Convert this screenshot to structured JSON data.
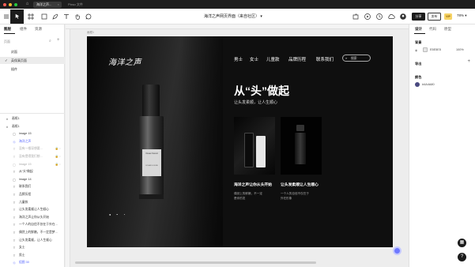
{
  "os": {
    "tabs": [
      {
        "label": "海洋之声...",
        "active": true
      },
      {
        "label": "Pixso 文件",
        "active": false
      }
    ],
    "colors": {
      "close": "#ff5f56",
      "min": "#ffbd2e",
      "max": "#27c93f"
    }
  },
  "toolbar": {
    "title": "海洋之声网页界面（来自社区）",
    "share_label": "分享",
    "publish_label": "发布",
    "vip_label": "VIP",
    "zoom": "78%"
  },
  "left_panel": {
    "tabs": [
      "图层",
      "组件",
      "资源"
    ],
    "pages_label": "页面",
    "pages": [
      {
        "label": "封面",
        "selected": false
      },
      {
        "label": "英保真页面",
        "selected": true
      },
      {
        "label": "插件",
        "selected": false
      }
    ],
    "layers": [
      {
        "label": "画框1",
        "icon": "#",
        "indent": 0,
        "style": "normal"
      },
      {
        "label": "画框1",
        "icon": "#",
        "indent": 0,
        "style": "normal"
      },
      {
        "label": "image 15",
        "icon": "▢",
        "indent": 1,
        "style": "normal"
      },
      {
        "label": "海洋之声",
        "icon": "◇",
        "indent": 1,
        "style": "blue"
      },
      {
        "label": "没有一根深想要...",
        "icon": "T",
        "indent": 1,
        "style": "grey"
      },
      {
        "label": "没有提得我们想...",
        "icon": "T",
        "indent": 1,
        "style": "grey"
      },
      {
        "label": "image 15",
        "icon": "▢",
        "indent": 1,
        "style": "grey"
      },
      {
        "label": "从“头”做起",
        "icon": "T",
        "indent": 1,
        "style": "normal"
      },
      {
        "label": "image 14",
        "icon": "▢",
        "indent": 1,
        "style": "normal"
      },
      {
        "label": "联系我们",
        "icon": "T",
        "indent": 1,
        "style": "normal"
      },
      {
        "label": "品牌历程",
        "icon": "T",
        "indent": 1,
        "style": "normal"
      },
      {
        "label": "儿童款",
        "icon": "T",
        "indent": 1,
        "style": "normal"
      },
      {
        "label": "让头发柔顺让人生顺心",
        "icon": "T",
        "indent": 1,
        "style": "normal"
      },
      {
        "label": "海洋之声让你从头开始",
        "icon": "T",
        "indent": 1,
        "style": "normal"
      },
      {
        "label": "一个人的自信不仅在于外在...",
        "icon": "T",
        "indent": 1,
        "style": "normal"
      },
      {
        "label": "偶然上的鲜嫩，不一定是梦...",
        "icon": "T",
        "indent": 1,
        "style": "normal"
      },
      {
        "label": "让头发柔顺，让人生顺心",
        "icon": "T",
        "indent": 1,
        "style": "normal"
      },
      {
        "label": "女士",
        "icon": "T",
        "indent": 1,
        "style": "normal"
      },
      {
        "label": "男士",
        "icon": "T",
        "indent": 1,
        "style": "normal"
      },
      {
        "label": "组图 30",
        "icon": "◇",
        "indent": 1,
        "style": "blue"
      }
    ]
  },
  "canvas": {
    "frame_label": "画框1"
  },
  "design": {
    "brand": "海洋之声",
    "nav": [
      "男士",
      "女士",
      "儿童款",
      "品牌历程",
      "联系我们"
    ],
    "search_placeholder": "搜索",
    "headline": "从“头”做起",
    "subline": "让头发柔顺，让人生顺心",
    "bottle_label_top": "Ocean Sound",
    "bottle_label_mid": "OCEAN SOUND",
    "cards": [
      {
        "title": "海洋之声让你从头开始",
        "desc1": "偶然上的鲜嫩，不一定",
        "desc2": "是你的发",
        "image": "bottle-card-white"
      },
      {
        "title": "让头发柔顺让人生顺心",
        "desc1": "一个人的自信不仅在于",
        "desc2": "外在形象",
        "image": "bottle-card-black"
      }
    ],
    "colors": {
      "background": "#0f0f0f",
      "accent_text": "#ffffff"
    }
  },
  "right_panel": {
    "tabs": [
      "设计",
      "代码",
      "原型"
    ],
    "background_label": "背景",
    "bg_hex": "E5E5E5",
    "bg_opacity": "100%",
    "export_label": "导出",
    "color_label": "颜色",
    "color_hex": "#4A4A80",
    "colors": {
      "bg_swatch": "#e5e5e5",
      "color_swatch": "#4a4a80"
    }
  }
}
